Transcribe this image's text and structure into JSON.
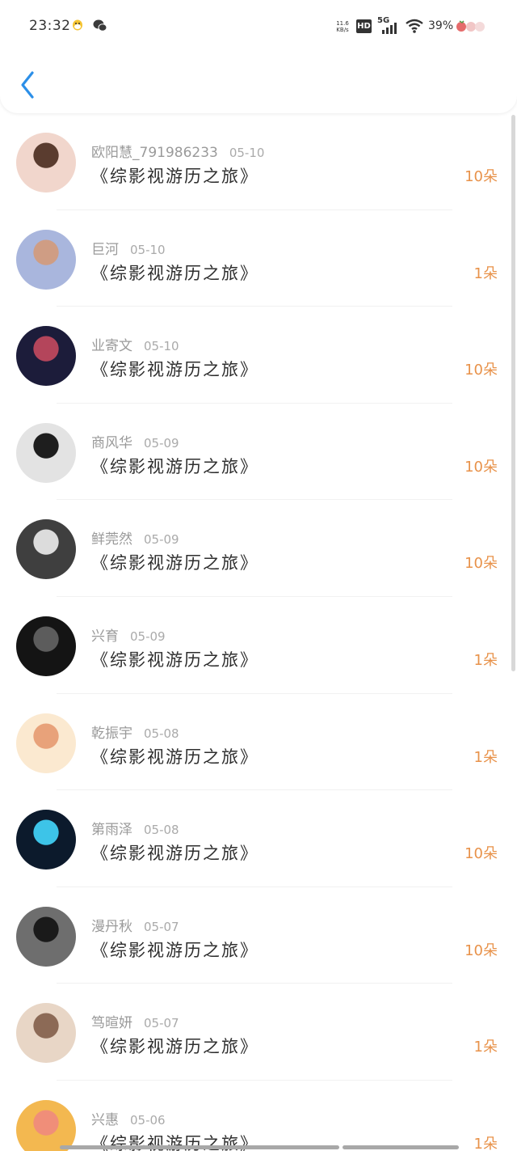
{
  "status_bar": {
    "time": "23:32",
    "net_speed": "11.6\nKB/s",
    "hd": "HD",
    "signal": "5G",
    "battery": "39%",
    "icons": [
      "qq-icon",
      "wechat-icon",
      "signal-icon",
      "wifi-icon",
      "fruit-icon"
    ]
  },
  "colors": {
    "amount": "#e8924a",
    "back": "#2c8fe8",
    "name": "#9a9a9a"
  },
  "records": [
    {
      "name": "欧阳慧_791986233",
      "date": "05-10",
      "book": "《综影视游历之旅》",
      "amount": "10朵",
      "avatar": [
        "#f1d6cc",
        "#5a3c2f"
      ]
    },
    {
      "name": "巨河",
      "date": "05-10",
      "book": "《综影视游历之旅》",
      "amount": "1朵",
      "avatar": [
        "#a9b6dd",
        "#cf9d84"
      ]
    },
    {
      "name": "业寄文",
      "date": "05-10",
      "book": "《综影视游历之旅》",
      "amount": "10朵",
      "avatar": [
        "#1c1c3a",
        "#b4455b"
      ]
    },
    {
      "name": "商风华",
      "date": "05-09",
      "book": "《综影视游历之旅》",
      "amount": "10朵",
      "avatar": [
        "#e3e3e3",
        "#1e1e1e"
      ]
    },
    {
      "name": "鲜莞然",
      "date": "05-09",
      "book": "《综影视游历之旅》",
      "amount": "10朵",
      "avatar": [
        "#3f3f3f",
        "#dcdcdc"
      ]
    },
    {
      "name": "兴育",
      "date": "05-09",
      "book": "《综影视游历之旅》",
      "amount": "1朵",
      "avatar": [
        "#141414",
        "#5c5c5c"
      ]
    },
    {
      "name": "乾振宇",
      "date": "05-08",
      "book": "《综影视游历之旅》",
      "amount": "1朵",
      "avatar": [
        "#fbe9d0",
        "#e8a27a"
      ]
    },
    {
      "name": "第雨泽",
      "date": "05-08",
      "book": "《综影视游历之旅》",
      "amount": "10朵",
      "avatar": [
        "#0c1a2c",
        "#3dc4e8"
      ]
    },
    {
      "name": "漫丹秋",
      "date": "05-07",
      "book": "《综影视游历之旅》",
      "amount": "10朵",
      "avatar": [
        "#6e6e6e",
        "#1a1a1a"
      ]
    },
    {
      "name": "笃暄妍",
      "date": "05-07",
      "book": "《综影视游历之旅》",
      "amount": "1朵",
      "avatar": [
        "#e8d6c6",
        "#8c6a56"
      ]
    },
    {
      "name": "兴惠",
      "date": "05-06",
      "book": "《综影视游历之旅》",
      "amount": "1朵",
      "avatar": [
        "#f3b850",
        "#f08e79"
      ]
    }
  ]
}
